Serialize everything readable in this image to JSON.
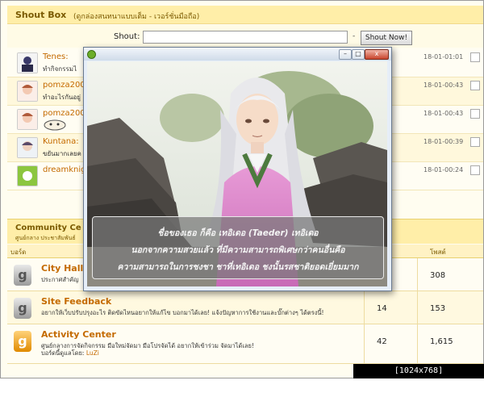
{
  "shoutbox": {
    "title": "Shout Box",
    "subtitle": "(ดูกล่องสนทนาแบบเต็ม - เวอร์ชั่นมือถือ)",
    "input_label": "Shout:",
    "input_value": "",
    "separator": "-",
    "button_label": "Shout Now!",
    "items": [
      {
        "user": "Tenes",
        "suffix": ":",
        "message": "ทำกิจกรรมไ",
        "time": "18-01-01:01"
      },
      {
        "user": "pomza200",
        "suffix": "",
        "message": "ทำอะไรกันอยู่",
        "time": "18-01-00:43"
      },
      {
        "user": "pomza200",
        "suffix": "",
        "message": "",
        "time": "18-01-00:43"
      },
      {
        "user": "Kuntana",
        "suffix": ":",
        "message": "ขยันมากเลยค",
        "time": "18-01-00:39"
      },
      {
        "user": "dreamknig",
        "suffix": "",
        "message": "",
        "time": "18-01-00:24"
      }
    ]
  },
  "community": {
    "title": "Community Ce",
    "subtitle": "ศูนย์กลาง ประชาสัมพันธ์",
    "col_board": "บอร์ด",
    "col_posts": "โพสต์",
    "forums": [
      {
        "name": "City Hall",
        "desc": "ประกาศสำคัญ",
        "moderators_label": "",
        "moderator": "",
        "topics": "",
        "posts": "308",
        "icon_letter": "g",
        "icon_color": "gray"
      },
      {
        "name": "Site Feedback",
        "desc": "อยากให้เว็บปรับปรุงอะไร ติดขัดไหนอยากให้แก้ไข บอกมาได้เลย! แจ้งปัญหาการใช้งานและบั๊กต่างๆ ได้ตรงนี้!",
        "moderators_label": "",
        "moderator": "",
        "topics": "14",
        "posts": "153",
        "icon_letter": "g",
        "icon_color": "gray"
      },
      {
        "name": "Activity Center",
        "desc": "ศูนย์กลางการจัดกิจกรรม มือใหม่จัดมา มือโปรจัดได้ อยากให้เข้าร่วม จัดมาได้เลย!",
        "moderators_label": "บอร์ดนี้ดูแลโดย:",
        "moderator": "LuZi",
        "topics": "42",
        "posts": "1,615",
        "icon_letter": "g",
        "icon_color": "orange"
      }
    ]
  },
  "window": {
    "min_label": "–",
    "max_label": "□",
    "close_label": "x",
    "dialog_lines": [
      "ชื่อของเธอ ก็คือ เทอิเดอ (Taeder) เทอิเดอ",
      "นอกจากความสวยแล้ว ที่มีความสามารถพิเศษกว่าคนอื่นคือ",
      "ความสามารถในการชงชา ชาที่เทอิเดอ ชงนั้นรสชาติยอดเยี่ยมมาก"
    ]
  },
  "watermark": "[1024x768] https://upic.me/",
  "colors": {
    "accent": "#c46a00",
    "header_bg": "#ffeea8",
    "window_frame": "#e6eef8"
  }
}
